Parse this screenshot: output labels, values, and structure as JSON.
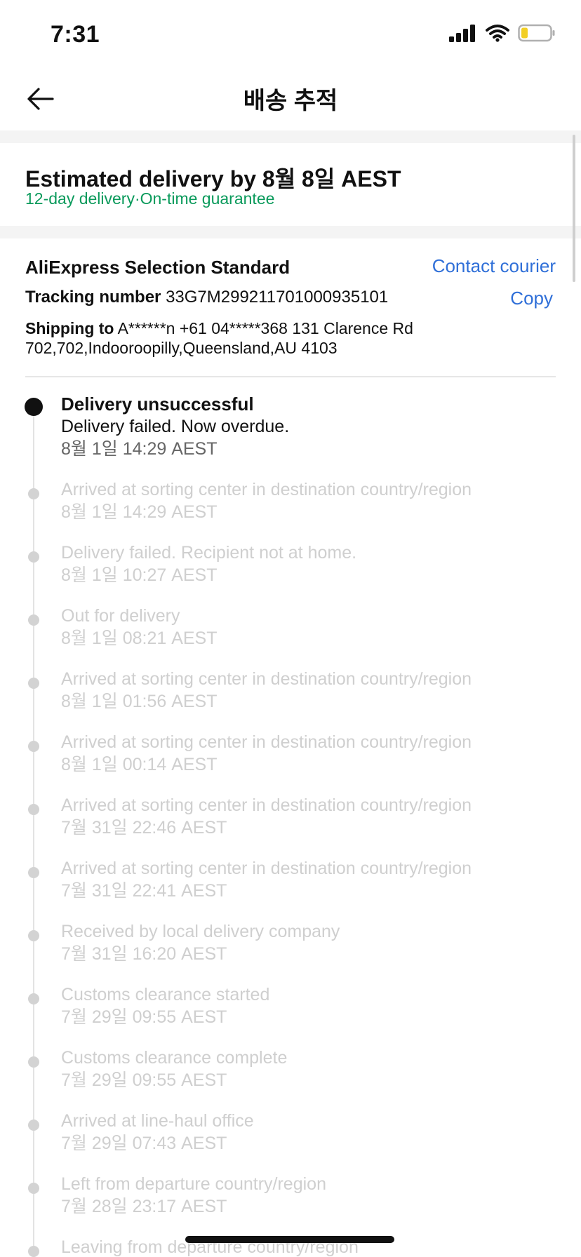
{
  "status_bar": {
    "time": "7:31",
    "icons": [
      "signal-icon",
      "wifi-icon",
      "battery-low-icon"
    ]
  },
  "nav": {
    "title": "배송 추적",
    "back_icon": "arrow-left-icon"
  },
  "estimate": {
    "title": "Estimated delivery by 8월 8일 AEST",
    "subtitle": "12-day delivery·On-time guarantee",
    "subtitle_color": "#0a9a5b"
  },
  "shipment": {
    "courier": "AliExpress Selection Standard",
    "contact_label": "Contact courier",
    "tracking_label": "Tracking number",
    "tracking_number": "33G7M299211701000935101",
    "copy_label": "Copy",
    "shipping_label": "Shipping to",
    "address": "A******n +61 04*****368 131 Clarence Rd 702,702,Indooroopilly,Queensland,AU 4103",
    "link_color": "#2f6fd8"
  },
  "timeline": {
    "current": {
      "title": "Delivery unsuccessful",
      "description": "Delivery failed. Now overdue.",
      "time": "8월 1일 14:29 AEST"
    },
    "events": [
      {
        "description": "Arrived at sorting center in destination country/region",
        "time": "8월 1일 14:29 AEST"
      },
      {
        "description": "Delivery failed. Recipient not at home.",
        "time": "8월 1일 10:27 AEST"
      },
      {
        "description": "Out for delivery",
        "time": "8월 1일 08:21 AEST"
      },
      {
        "description": "Arrived at sorting center in destination country/region",
        "time": "8월 1일 01:56 AEST"
      },
      {
        "description": "Arrived at sorting center in destination country/region",
        "time": "8월 1일 00:14 AEST"
      },
      {
        "description": "Arrived at sorting center in destination country/region",
        "time": "7월 31일 22:46 AEST"
      },
      {
        "description": "Arrived at sorting center in destination country/region",
        "time": "7월 31일 22:41 AEST"
      },
      {
        "description": "Received by local delivery company",
        "time": "7월 31일 16:20 AEST"
      },
      {
        "description": "Customs clearance started",
        "time": "7월 29일 09:55 AEST"
      },
      {
        "description": "Customs clearance complete",
        "time": "7월 29일 09:55 AEST"
      },
      {
        "description": "Arrived at line-haul office",
        "time": "7월 29일 07:43 AEST"
      },
      {
        "description": "Left from departure country/region",
        "time": "7월 28일 23:17 AEST"
      },
      {
        "description": "Leaving from departure country/region",
        "time": ""
      }
    ]
  }
}
